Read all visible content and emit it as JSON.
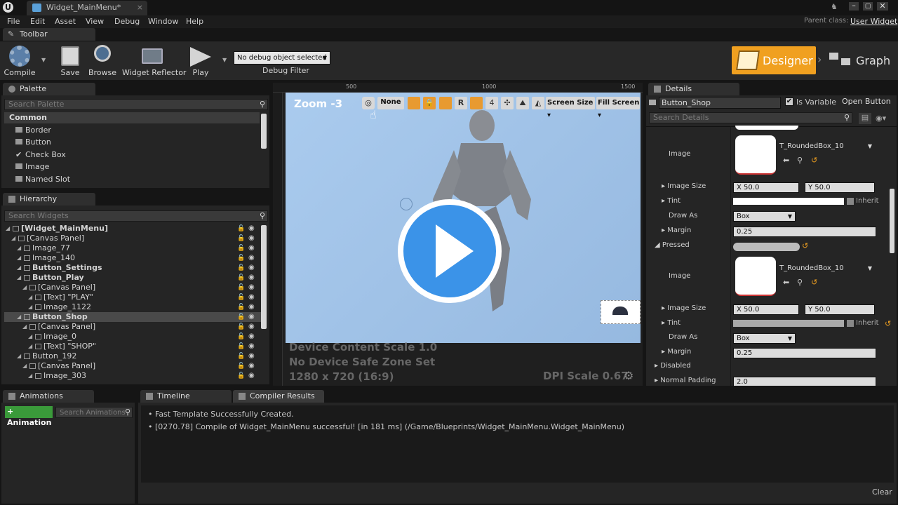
{
  "window": {
    "tab_title": "Widget_MainMenu*",
    "parent_class_label": "Parent class:",
    "parent_class_value": "User Widget"
  },
  "menu": [
    "File",
    "Edit",
    "Asset",
    "View",
    "Debug",
    "Window",
    "Help"
  ],
  "toolbar": {
    "tab_label": "Toolbar",
    "compile": "Compile",
    "save": "Save",
    "browse": "Browse",
    "widget_reflector": "Widget Reflector",
    "play": "Play",
    "debug_select": "No debug object selected",
    "debug_filter": "Debug Filter",
    "designer": "Designer",
    "graph": "Graph"
  },
  "palette": {
    "tab": "Palette",
    "search_placeholder": "Search Palette",
    "category": "Common",
    "items": [
      "Border",
      "Button",
      "Check Box",
      "Image",
      "Named Slot"
    ]
  },
  "hierarchy": {
    "tab": "Hierarchy",
    "search_placeholder": "Search Widgets",
    "rows": [
      {
        "label": "[Widget_MainMenu]",
        "bold": true,
        "indent": 0
      },
      {
        "label": "[Canvas Panel]",
        "bold": false,
        "indent": 1
      },
      {
        "label": "Image_77",
        "bold": false,
        "indent": 2
      },
      {
        "label": "Image_140",
        "bold": false,
        "indent": 2
      },
      {
        "label": "Button_Settings",
        "bold": true,
        "indent": 2
      },
      {
        "label": "Button_Play",
        "bold": true,
        "indent": 2
      },
      {
        "label": "[Canvas Panel]",
        "bold": false,
        "indent": 3
      },
      {
        "label": "[Text] \"PLAY\"",
        "bold": false,
        "indent": 4
      },
      {
        "label": "Image_1122",
        "bold": false,
        "indent": 4
      },
      {
        "label": "Button_Shop",
        "bold": true,
        "indent": 2,
        "selected": true
      },
      {
        "label": "[Canvas Panel]",
        "bold": false,
        "indent": 3
      },
      {
        "label": "Image_0",
        "bold": false,
        "indent": 4
      },
      {
        "label": "[Text] \"SHOP\"",
        "bold": false,
        "indent": 4
      },
      {
        "label": "Button_192",
        "bold": false,
        "indent": 2
      },
      {
        "label": "[Canvas Panel]",
        "bold": false,
        "indent": 3
      },
      {
        "label": "Image_303",
        "bold": false,
        "indent": 4
      }
    ]
  },
  "viewport": {
    "ruler_marks": [
      "500",
      "1000",
      "1500"
    ],
    "zoom": "Zoom -3",
    "none_btn": "None",
    "r_btn": "R",
    "grid_num": "4",
    "screen_size": "Screen Size",
    "fill_screen": "Fill Screen",
    "content_scale": "Device Content Scale 1.0",
    "safe_zone": "No Device Safe Zone Set",
    "resolution": "1280 x 720 (16:9)",
    "dpi": "DPI Scale 0.67"
  },
  "details": {
    "tab": "Details",
    "name": "Button_Shop",
    "is_variable": "Is Variable",
    "open_button": "Open Button",
    "search_placeholder": "Search Details",
    "image_label": "Image",
    "texture": "T_RoundedBox_10",
    "image_size": "Image Size",
    "x_label": "X",
    "y_label": "Y",
    "size_x": "50.0",
    "size_y": "50.0",
    "tint": "Tint",
    "inherit": "Inherit",
    "draw_as": "Draw As",
    "draw_as_value": "Box",
    "margin": "Margin",
    "margin_value": "0.25",
    "pressed": "Pressed",
    "disabled": "Disabled",
    "normal_padding": "Normal Padding",
    "normal_padding_value": "2.0"
  },
  "bottom": {
    "animations_tab": "Animations",
    "add_animation": "+ Animation",
    "search_animations": "Search Animations",
    "timeline_tab": "Timeline",
    "compiler_tab": "Compiler Results",
    "log": [
      "Fast Template Successfully Created.",
      "[0270.78] Compile of Widget_MainMenu successful! [in 181 ms] (/Game/Blueprints/Widget_MainMenu.Widget_MainMenu)"
    ],
    "clear": "Clear"
  },
  "colors": {
    "designer_accent": "#f0a020",
    "viewport_bg": "#a4c4e6",
    "play_overlay": "#3b93e8"
  }
}
